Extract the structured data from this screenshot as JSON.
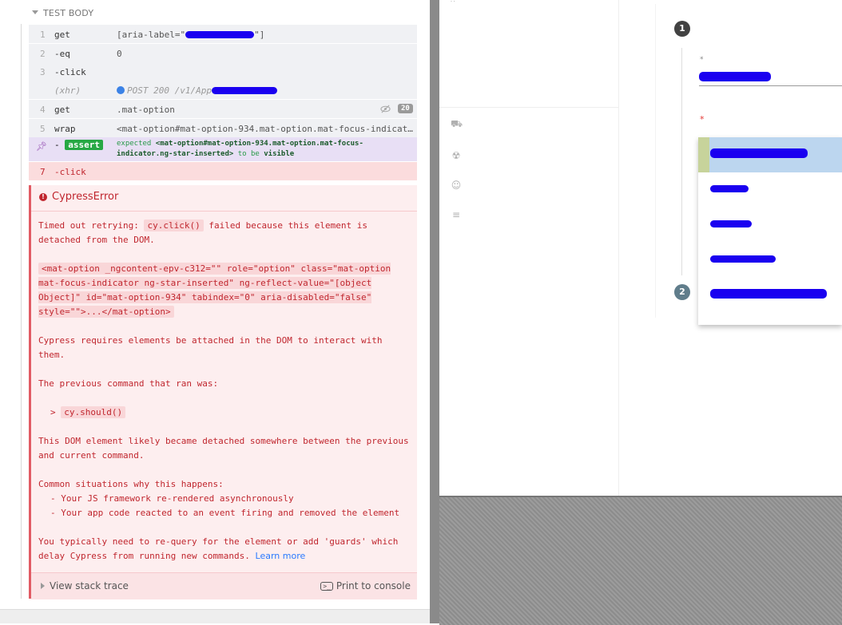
{
  "reporter": {
    "section_title": "TEST BODY",
    "commands": [
      {
        "num": "1",
        "name": "get",
        "message": "[aria-label=\"",
        "message_suffix": "\"]"
      },
      {
        "num": "2",
        "name": "-eq",
        "message": "0"
      },
      {
        "num": "3",
        "name": "-click",
        "message": ""
      },
      {
        "num": "",
        "name": "(xhr)",
        "message": "POST 200 /v1/App"
      },
      {
        "num": "4",
        "name": "get",
        "message": ".mat-option",
        "badge": "20"
      },
      {
        "num": "5",
        "name": "wrap",
        "message": "<mat-option#mat-option-934.mat-option.mat-focus-indicat…"
      },
      {
        "num": "",
        "name": "-assert",
        "message_prefix": "expected",
        "message_subject": "<mat-option#mat-option-934.mat-option.mat-focus-indicator.ng-star-inserted>",
        "message_mid": "to be",
        "message_value": "visible"
      },
      {
        "num": "7",
        "name": "-click",
        "message": ""
      }
    ],
    "error": {
      "title": "CypressError",
      "p1_a": "Timed out retrying:",
      "p1_code": "cy.click()",
      "p1_b": "failed because this element is detached from the DOM.",
      "p2_code": "<mat-option _ngcontent-epv-c312=\"\" role=\"option\" class=\"mat-option mat-focus-indicator ng-star-inserted\" ng-reflect-value=\"[object Object]\" id=\"mat-option-934\" tabindex=\"0\" aria-disabled=\"false\" style=\"\">...</mat-option>",
      "p3": "Cypress requires elements be attached in the DOM to interact with them.",
      "p4": "The previous command that ran was:",
      "p5_prefix": ">",
      "p5_code": "cy.should()",
      "p6": "This DOM element likely became detached somewhere between the previous and current command.",
      "p7": "Common situations why this happens:",
      "p7_item1": "- Your JS framework re-rendered asynchronously",
      "p7_item2": "- Your app code reacted to an event firing and removed the element",
      "p8": "You typically need to re-query for the element or add 'guards' which delay Cypress from running new commands.",
      "learn_more": "Learn more",
      "view_stack": "View stack trace",
      "print_console": "Print to console",
      "console_icon": ">_"
    }
  },
  "app": {
    "step1": "1",
    "step2": "2",
    "field1_asterisk": "*",
    "field2_asterisk": "*",
    "colors": {
      "step_active": "#424242",
      "step_inactive": "#607d8b",
      "error": "#e53935",
      "highlight": "#bcd6ef",
      "redaction": "#1a00f0"
    },
    "sidebar_icons": [
      "truck-icon",
      "alarm-icon",
      "user-settings-icon",
      "columns-icon"
    ]
  }
}
